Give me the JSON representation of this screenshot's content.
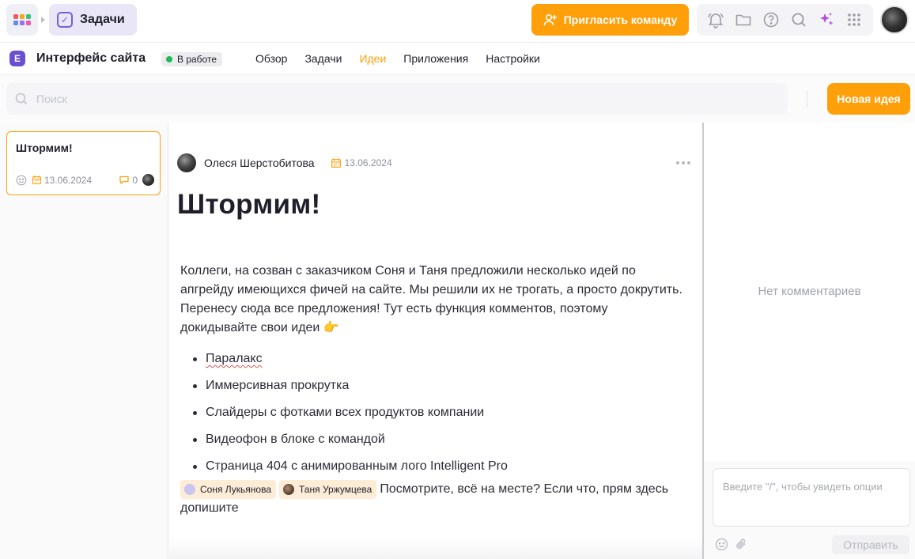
{
  "topbar": {
    "app_name": "Задачи",
    "invite_label": "Пригласить команду",
    "icons": [
      "bell-icon",
      "folder-icon",
      "help-icon",
      "search-icon",
      "sparkles-icon",
      "grid-icon"
    ]
  },
  "project": {
    "logo_letter": "E",
    "title": "Интерфейс сайта",
    "status": "В работе",
    "nav": [
      "Обзор",
      "Задачи",
      "Идеи",
      "Приложения",
      "Настройки"
    ],
    "active_nav": "Идеи"
  },
  "search": {
    "placeholder": "Поиск",
    "value": ""
  },
  "new_idea_label": "Новая идея",
  "idea_list": [
    {
      "title": "Штормим!",
      "date": "13.06.2024",
      "comments": "0"
    }
  ],
  "idea": {
    "author": "Олеся Шерстобитова",
    "date": "13.06.2024",
    "title": "Штормим!",
    "intro": "Коллеги, на созван с заказчиком Соня и Таня предложили несколько идей по апгрейду имеющихся фичей на сайте. Мы решили их не трогать, а просто докрутить. Перенесу сюда все предложения! Тут есть функция комментов, поэтому докидывайте свои идеи 👉",
    "bullets": [
      "Паралакс",
      "Иммерсивная прокрутка",
      "Слайдеры с фотками всех продуктов компании",
      "Видеофон в блоке с командой",
      "Страница 404 с анимированным лого Intelligent Pro"
    ],
    "mentions": [
      "Соня Лукьянова",
      "Таня Уржумцева"
    ],
    "outro": "Посмотрите, всё на месте? Если что, прям здесь допишите"
  },
  "comments": {
    "empty_text": "Нет комментариев",
    "input_placeholder": "Введите \"/\", чтобы увидеть опции",
    "send_label": "Отправить"
  },
  "colors": {
    "accent": "#ff9f0a",
    "brand": "#6a4fd0",
    "status_green": "#1db954"
  }
}
